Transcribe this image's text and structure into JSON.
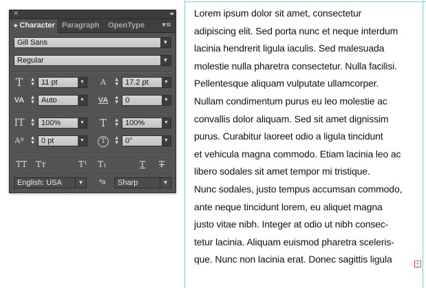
{
  "panel": {
    "close_glyph": "×",
    "collapse_glyph": "◂◂",
    "tabs": [
      {
        "label": "Character",
        "active": true
      },
      {
        "label": "Paragraph",
        "active": false
      },
      {
        "label": "OpenType",
        "active": false
      }
    ],
    "tab_marker": "◆",
    "menu_glyph": "▾≡",
    "font_family": "Gill Sans",
    "font_style": "Regular",
    "font_size": "11 pt",
    "leading": "17.2 pt",
    "kerning": "Auto",
    "tracking": "0",
    "vertical_scale": "100%",
    "horizontal_scale": "100%",
    "baseline_shift": "0 pt",
    "rotation": "0°",
    "language": "English: USA",
    "antialiasing": "Sharp",
    "icons": {
      "font_size": "font-size-icon",
      "leading": "leading-icon",
      "kerning": "kerning-icon",
      "tracking": "tracking-icon",
      "vertical_scale": "vertical-scale-icon",
      "horizontal_scale": "horizontal-scale-icon",
      "baseline_shift": "baseline-shift-icon",
      "rotation": "character-rotation-icon",
      "antialias": "antialias-icon"
    },
    "style_buttons": {
      "all_caps": "TT",
      "small_caps": "Tт",
      "superscript": "T¹",
      "subscript": "T₁",
      "underline": "T",
      "strikethrough": "T"
    },
    "glyphs": {
      "font_size": "T",
      "leading": "A",
      "kerning": "VA",
      "tracking": "VA",
      "vertical_scale": "IT",
      "horizontal_scale": "T",
      "baseline_shift": "Aª",
      "rotation": "T",
      "antialias": "ªa",
      "dropdown_arrow": "▼",
      "spin_up": "▲",
      "spin_down": "▼"
    }
  },
  "text_frame": {
    "lines": [
      "Lorem ipsum dolor sit amet, consectetur",
      "adipiscing elit. Sed porta nunc et neque interdum",
      "lacinia hendrerit ligula iaculis. Sed malesuada",
      "molestie nulla pharetra consectetur. Nulla facilisi.",
      "Pellentesque aliquam vulputate ullamcorper.",
      "Nullam condimentum purus eu leo molestie ac",
      "convallis dolor aliquam. Sed sit amet dignissim",
      "purus. Curabitur laoreet odio a ligula tincidunt",
      "et vehicula magna commodo. Etiam lacinia leo ac",
      "libero sodales sit amet tempor mi tristique.",
      "Nunc sodales, justo tempus accumsan commodo,",
      "ante neque tincidunt lorem, eu aliquet magna",
      "justo vitae nibh. Integer at odio ut nibh consec-",
      "tetur lacinia. Aliquam euismod pharetra sceleris-",
      "que. Nunc non lacinia erat. Donec sagittis ligula"
    ],
    "overset_glyph": "+"
  },
  "colors": {
    "panel_bg": "#535353",
    "frame_guide": "#8fd3e8",
    "overset": "#e05555"
  }
}
